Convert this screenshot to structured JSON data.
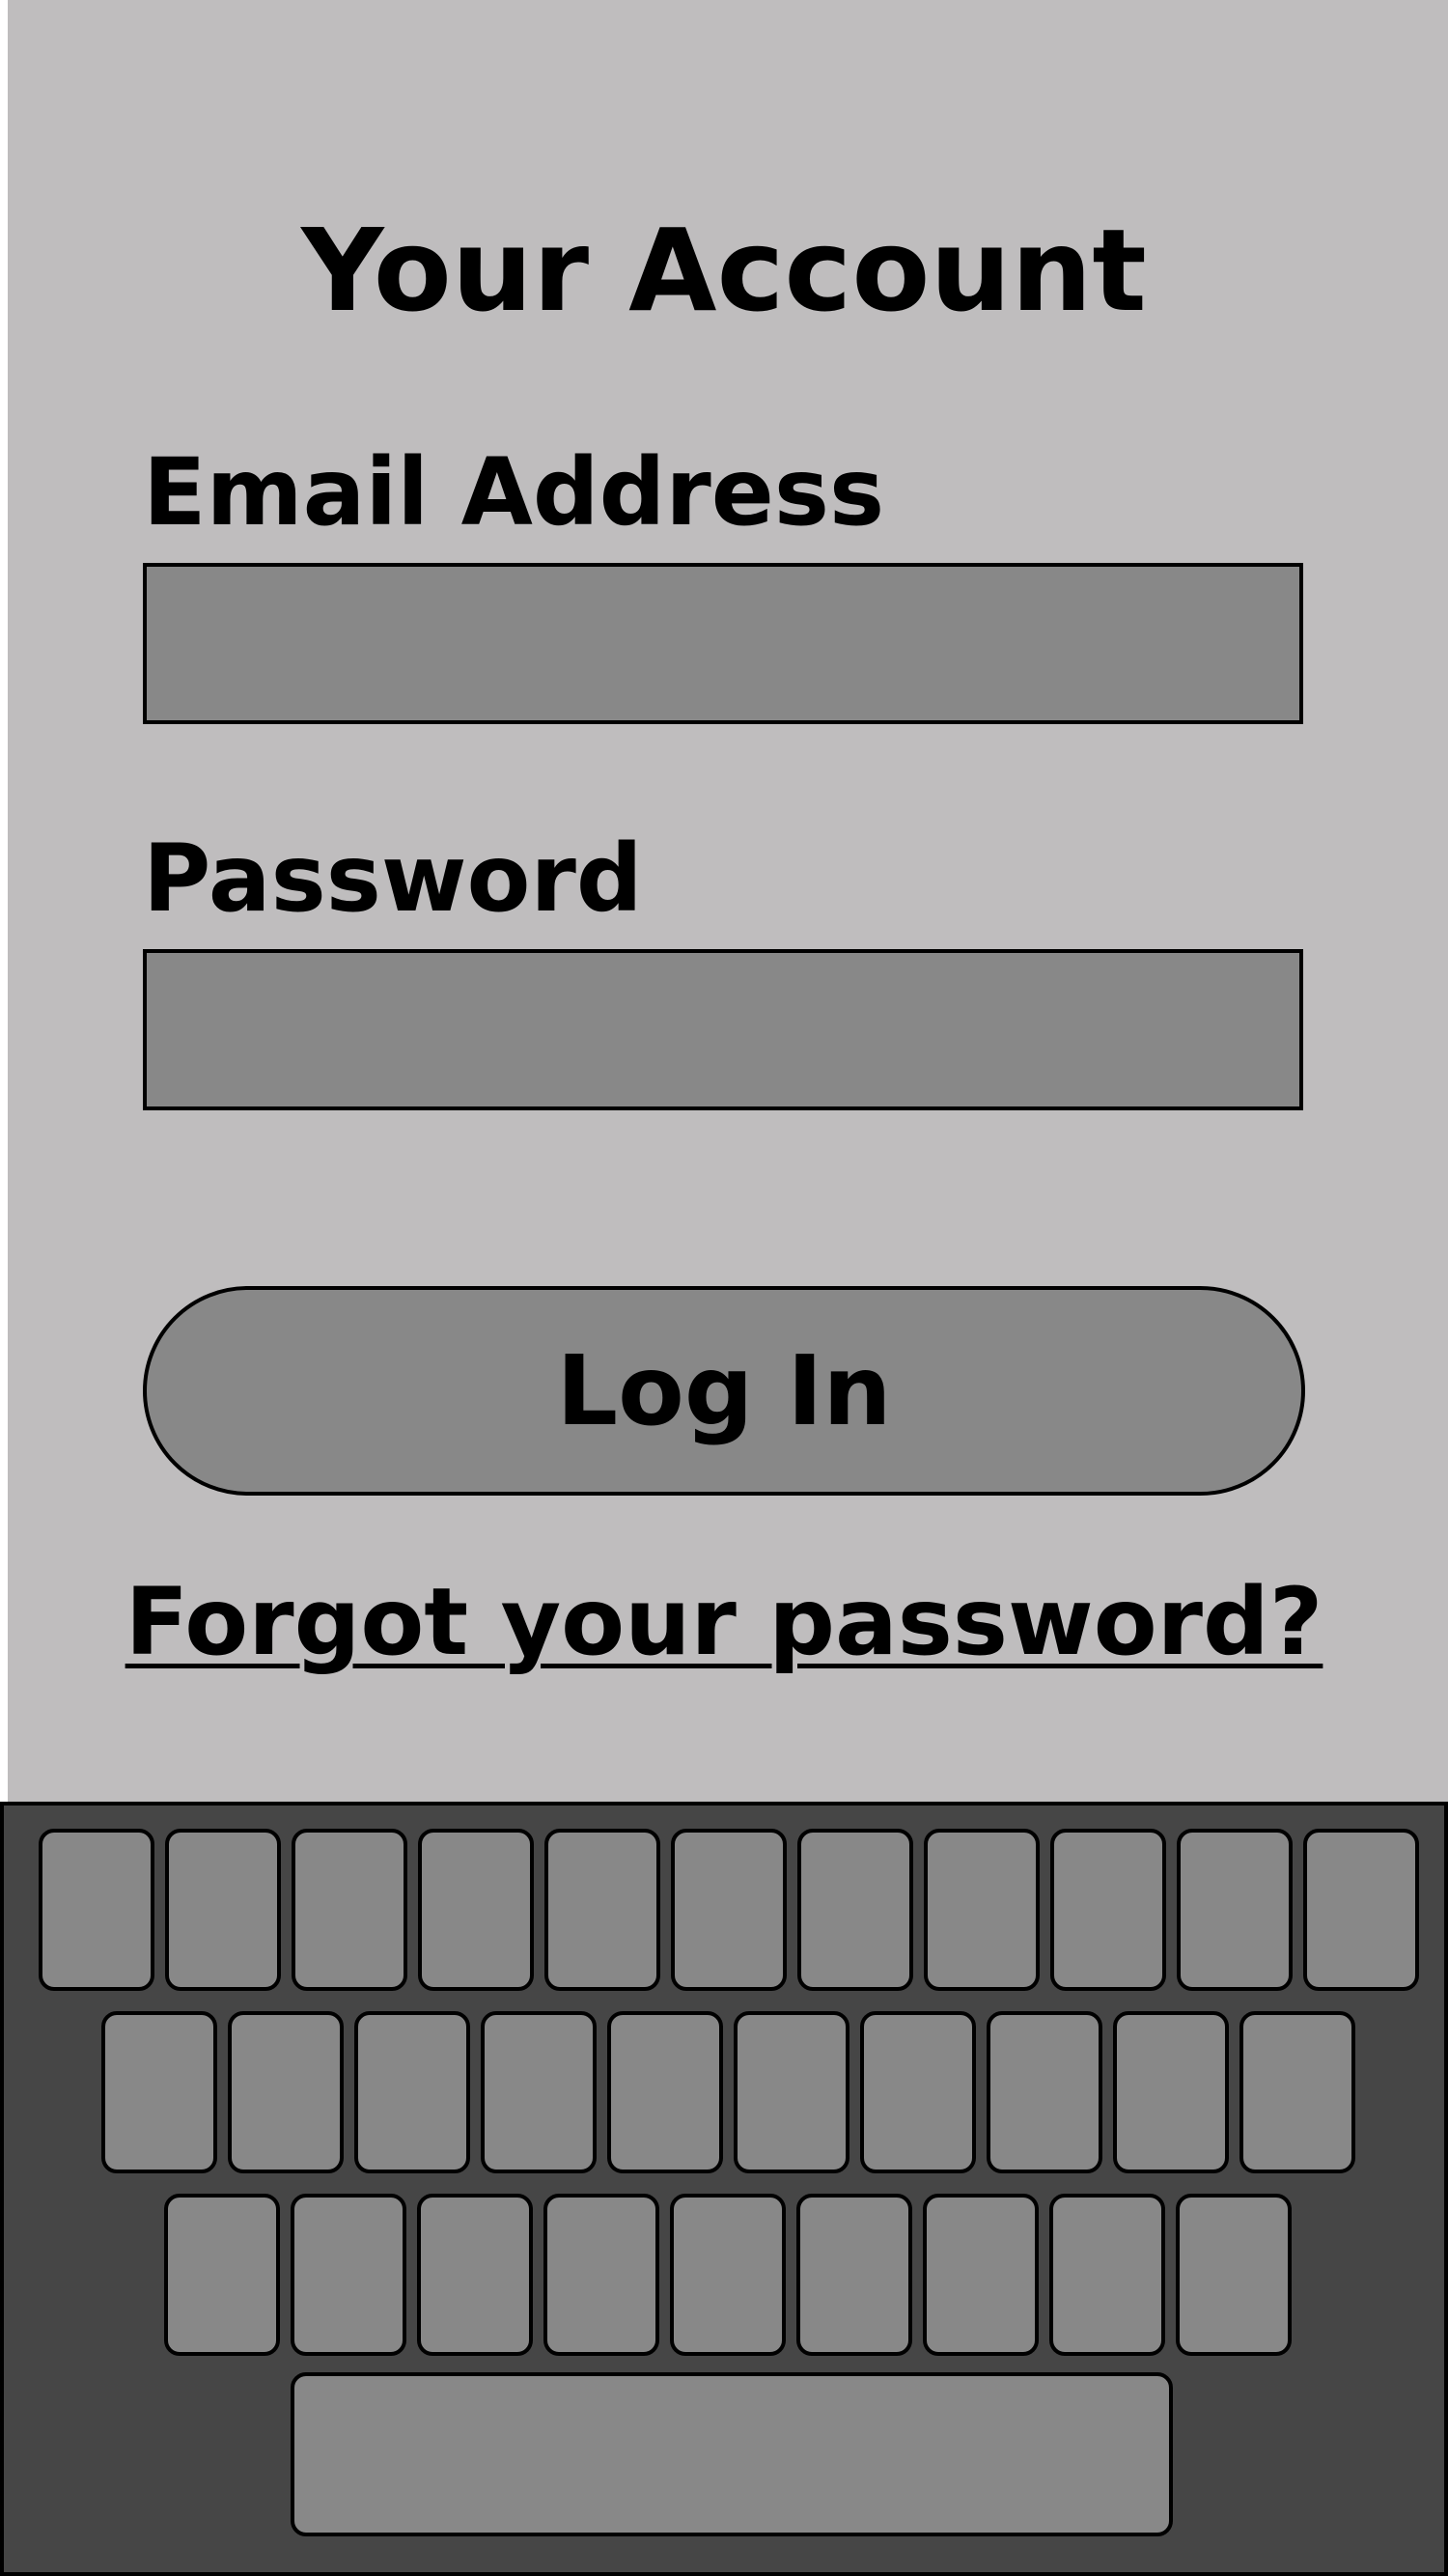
{
  "screen": {
    "title": "Your Account"
  },
  "form": {
    "email_label": "Email Address",
    "email_value": "",
    "password_label": "Password",
    "password_value": "",
    "login_label": "Log In",
    "forgot_label": "Forgot your password?"
  },
  "keyboard": {
    "rows": [
      {
        "key_count": 11
      },
      {
        "key_count": 10
      },
      {
        "key_count": 9
      }
    ],
    "has_spacebar": true
  },
  "colors": {
    "screen_background": "#bfbdbe",
    "control_fill": "#888888",
    "keyboard_background": "#464646",
    "outline": "#000000"
  }
}
